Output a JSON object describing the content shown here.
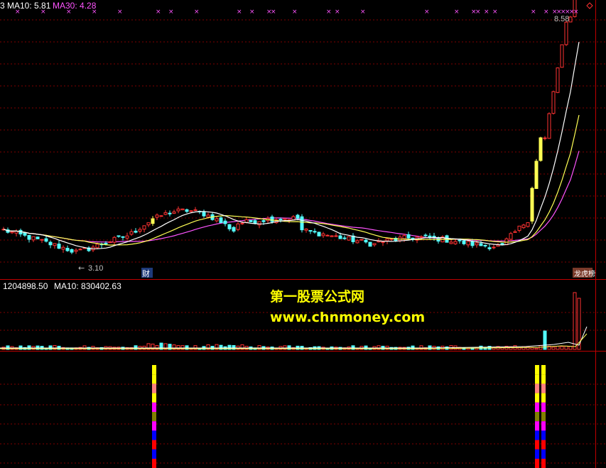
{
  "indicators": {
    "ma_prefix": "3",
    "ma10_label": "MA10: 5.81",
    "ma30_label": "MA30: 4.28",
    "vol_label": "1204898.50",
    "vol_ma10_label": "MA10: 830402.63"
  },
  "watermark": {
    "line1": "第一股票公式网",
    "line2": "www.chnmoney.com"
  },
  "colors": {
    "up": "#ff3232",
    "down": "#54ffff",
    "ma10": "#ffffff",
    "ma20": "#ffff54",
    "ma30": "#ff54ff",
    "grid": "#7f0000",
    "panel_border": "#c00000",
    "signal_yellow": "#ffff00",
    "signal_pink": "#ff8080",
    "signal_magenta": "#ff00ff",
    "signal_olive": "#808000",
    "signal_blue": "#0000ff",
    "signal_red": "#ff0000"
  },
  "chart_data": {
    "type": "candlestick",
    "price_labels": {
      "high": "8.58",
      "low": "3.10"
    },
    "markers": {
      "left": "财",
      "right": "龙虎榜"
    },
    "x_marks": [
      3,
      9,
      15,
      21,
      27,
      36,
      39,
      45,
      55,
      58,
      62,
      63,
      68,
      76,
      78,
      84,
      99,
      106,
      110,
      111,
      113,
      115,
      124,
      127,
      129,
      130,
      131,
      132,
      133,
      134
    ],
    "ma_series": [
      {
        "name": "MA10",
        "last": 5.81
      },
      {
        "name": "MA30",
        "last": 4.28
      }
    ],
    "volume": {
      "last": 1204898.5,
      "ma10": 830402.63
    },
    "signal_columns": [
      {
        "bar_index": 35,
        "colors": [
          "yellow",
          "yellow",
          "pink",
          "yellow",
          "magenta",
          "olive",
          "magenta",
          "blue",
          "red",
          "blue",
          "red"
        ]
      },
      {
        "bar_index": 124,
        "colors": [
          "yellow",
          "yellow",
          "pink",
          "yellow",
          "magenta",
          "olive",
          "magenta",
          "blue",
          "red",
          "blue",
          "red"
        ]
      },
      {
        "bar_index": 125,
        "colors": [
          "yellow",
          "yellow",
          "pink",
          "yellow",
          "magenta",
          "olive",
          "magenta",
          "blue",
          "red",
          "blue",
          "red"
        ]
      }
    ]
  }
}
